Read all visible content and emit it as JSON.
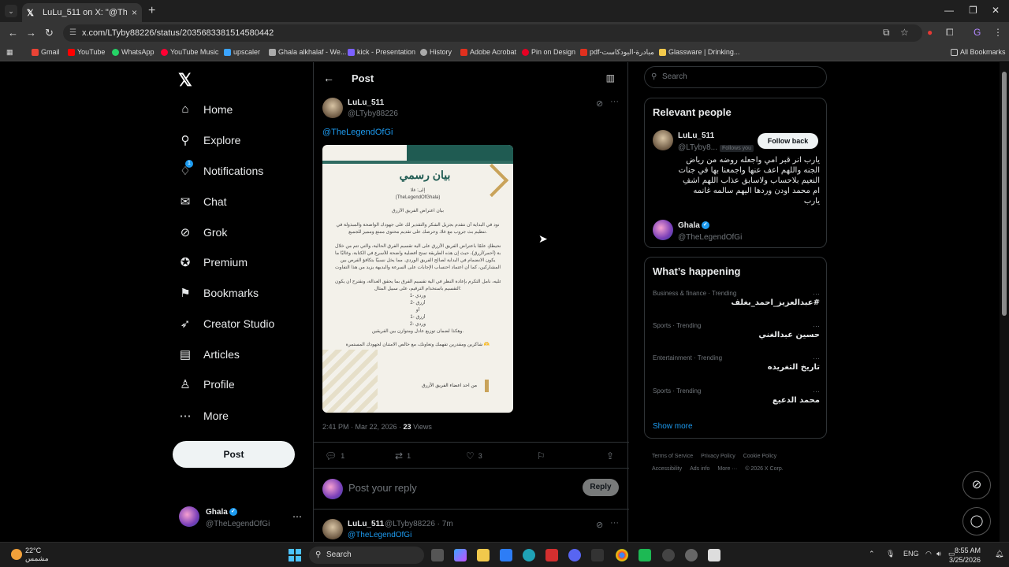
{
  "browser": {
    "tab_title": "LuLu_511 on X: \"@TheLegendO...",
    "url": "x.com/LTyby88226/status/2035683381514580442",
    "bookmarks": [
      {
        "label": "Gmail",
        "color": "#ea4335"
      },
      {
        "label": "YouTube",
        "color": "#ff0000"
      },
      {
        "label": "WhatsApp",
        "color": "#25d366"
      },
      {
        "label": "YouTube Music",
        "color": "#ff0033"
      },
      {
        "label": "upscaler",
        "color": "#3ba4ff"
      },
      {
        "label": "Ghala alkhalaf - We...",
        "color": "#aaaaaa"
      },
      {
        "label": "kick - Presentation",
        "color": "#7b61ff"
      },
      {
        "label": "History",
        "color": "#aaaaaa"
      },
      {
        "label": "Adobe Acrobat",
        "color": "#e0301e"
      },
      {
        "label": "Pin on Design",
        "color": "#e60023"
      },
      {
        "label": "pdf-مبادرة-البودكاست",
        "color": "#e0301e"
      },
      {
        "label": "Glassware | Drinking...",
        "color": "#f2c94c"
      }
    ],
    "all_bookmarks": "All Bookmarks"
  },
  "sidebar": {
    "items": [
      {
        "label": "Home",
        "icon": "home-icon",
        "glyph": "⌂"
      },
      {
        "label": "Explore",
        "icon": "search-icon",
        "glyph": "⚲"
      },
      {
        "label": "Notifications",
        "icon": "bell-icon",
        "glyph": "🔔"
      },
      {
        "label": "Chat",
        "icon": "mail-icon",
        "glyph": "✉"
      },
      {
        "label": "Grok",
        "icon": "grok-icon",
        "glyph": "⊘"
      },
      {
        "label": "Premium",
        "icon": "premium-icon",
        "glyph": "✪"
      },
      {
        "label": "Bookmarks",
        "icon": "bookmark-icon",
        "glyph": "⚑"
      },
      {
        "label": "Creator Studio",
        "icon": "rocket-icon",
        "glyph": "🚀"
      },
      {
        "label": "Articles",
        "icon": "article-icon",
        "glyph": "▤"
      },
      {
        "label": "Profile",
        "icon": "person-icon",
        "glyph": "👤"
      },
      {
        "label": "More",
        "icon": "more-icon",
        "glyph": "⋯"
      }
    ],
    "notification_badge": "1",
    "post_button": "Post",
    "account": {
      "name": "Ghala",
      "handle": "@TheLegendOfGi"
    }
  },
  "main": {
    "title": "Post",
    "tweet": {
      "name": "LuLu_511",
      "handle": "@LTyby88226",
      "mention": "@TheLegendOfGi",
      "doc": {
        "title": "بيان رسمي",
        "to": "إلى: غلا",
        "to_handle": "(TheLegendOfGhala)",
        "subject": "بيان اعتراض الفريق الأزرق",
        "lines": [
          "نود في البداية أن نتقدم بجزيل الشكر والتقدير لك على جهودك الواضحة والمبذولة في",
          "تنظيم بث جروب مع غلا، وحرصك على تقديم محتوى ممتع ومميز للجميع.",
          "نحيطكِ علمًا باعتراض الفريق الأزرق على آلية تقسيم الفرق الحالية، والتي تتم من خلال",
          "كتابة (أحمر/أزرق)، حيث إن هذه الطريقة تمنح أفضلية واضحة للأسرع في الكتابة، وغالبًا ما",
          "يكون الانضمام في البداية لصالح الفريق الوردي. مما يخل نسبيًا بتكافؤ الفرص بين",
          "المشاركين، كما أن اعتماد احتساب الإجابات على السرعة والبديهة يزيد من هذا التفاوت.",
          "وعليه، نأمل التكرم بإعادة النظر في آلية تقسيم الفرق بما يحقق العدالة، ونقترح أن يكون",
          "التقسيم باستخدام الترقيم، على سبيل المثال:",
          "1- وردي",
          "2- أزرق",
          "أو",
          "1- أزرق",
          "2- وردي",
          "وهكذا لضمان توزيع عادل ومتوازن بين الفريقين.",
          "شاكرين ومقدرين تفهمك وتعاونك، مع خالص الامتنان لجهودك المستمرة 🫶"
        ],
        "signature": "من احد اعضاء الفريق الأزرق"
      },
      "time": "2:41 PM · Mar 22, 2026 · ",
      "views_count": "23",
      "views_label": " Views",
      "replies": "1",
      "reposts": "1",
      "likes": "3"
    },
    "reply_placeholder": "Post your reply",
    "reply_button": "Reply",
    "reply_tweet": {
      "name": "LuLu_511",
      "handle": "@LTyby88226 · 7m",
      "mention": "@TheLegendOfGi"
    }
  },
  "right": {
    "search_placeholder": "Search",
    "relevant_title": "Relevant people",
    "person1": {
      "name": "LuLu_511",
      "handle": "@LTyby8...",
      "follows_you": "Follows you",
      "follow_button": "Follow back",
      "bio": "يارب انر قبر امي واجعله روضه من رياض الجنه واللهم اعف عنها واجمعنا بها في جنات النعيم بلاحساب ولاسابق عذاب اللهم اشفِ ام محمد اودن وردها اليهم سالمه غانمه يارب"
    },
    "person2": {
      "name": "Ghala",
      "handle": "@TheLegendOfGi"
    },
    "happening_title": "What’s happening",
    "trends": [
      {
        "category": "Business & finance · Trending",
        "title": "#عبدالعزيز_احمد_بغلف"
      },
      {
        "category": "Sports · Trending",
        "title": "حسين عبدالغني"
      },
      {
        "category": "Entertainment · Trending",
        "title": "تاريخ التغريده"
      },
      {
        "category": "Sports · Trending",
        "title": "محمد الدعيع"
      }
    ],
    "show_more": "Show more",
    "footer": {
      "terms": "Terms of Service",
      "privacy": "Privacy Policy",
      "cookie": "Cookie Policy",
      "accessibility": "Accessibility",
      "ads": "Ads info",
      "more": "More ···",
      "copyright": "© 2026 X Corp."
    }
  },
  "taskbar": {
    "temp": "22°C",
    "weather": "مشمس",
    "search": "Search",
    "lang": "ENG",
    "time": "8:55 AM",
    "date": "3/25/2026"
  }
}
